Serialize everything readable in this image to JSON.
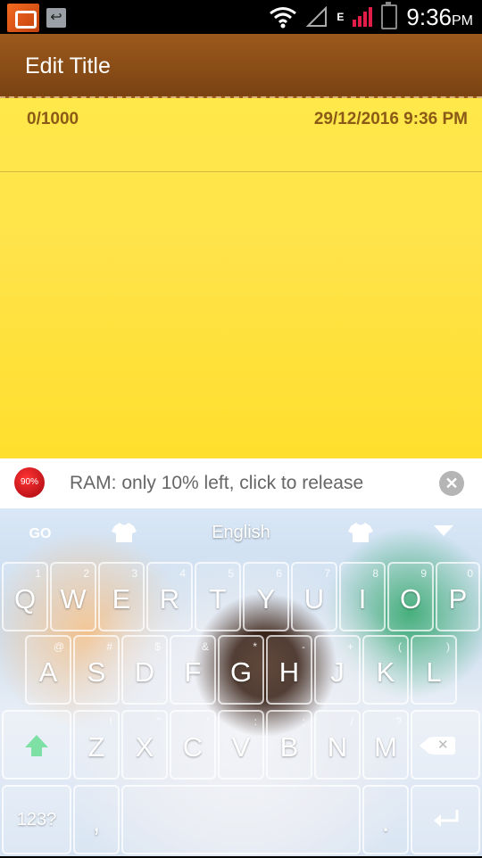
{
  "status_bar": {
    "time": "9:36",
    "ampm": "PM",
    "network": "E"
  },
  "title_bar": {
    "title": "Edit Title"
  },
  "note": {
    "char_count": "0/1000",
    "datetime": "29/12/2016   9:36 PM"
  },
  "ram_banner": {
    "badge": "90%",
    "text": "RAM: only 10% left, click to release",
    "close": "✕"
  },
  "keyboard": {
    "go_logo": "GO",
    "language": "English",
    "row1": [
      {
        "key": "Q",
        "hint": "1"
      },
      {
        "key": "W",
        "hint": "2"
      },
      {
        "key": "E",
        "hint": "3"
      },
      {
        "key": "R",
        "hint": "4"
      },
      {
        "key": "T",
        "hint": "5"
      },
      {
        "key": "Y",
        "hint": "6"
      },
      {
        "key": "U",
        "hint": "7"
      },
      {
        "key": "I",
        "hint": "8"
      },
      {
        "key": "O",
        "hint": "9"
      },
      {
        "key": "P",
        "hint": "0"
      }
    ],
    "row2": [
      {
        "key": "A",
        "hint": "@"
      },
      {
        "key": "S",
        "hint": "#"
      },
      {
        "key": "D",
        "hint": "$"
      },
      {
        "key": "F",
        "hint": "&"
      },
      {
        "key": "G",
        "hint": "*"
      },
      {
        "key": "H",
        "hint": "-"
      },
      {
        "key": "J",
        "hint": "+"
      },
      {
        "key": "K",
        "hint": "("
      },
      {
        "key": "L",
        "hint": ")"
      }
    ],
    "row3": [
      {
        "key": "Z",
        "hint": "!"
      },
      {
        "key": "X",
        "hint": "\""
      },
      {
        "key": "C",
        "hint": "'"
      },
      {
        "key": "V",
        "hint": ":"
      },
      {
        "key": "B",
        "hint": ";"
      },
      {
        "key": "N",
        "hint": "/"
      },
      {
        "key": "M",
        "hint": "?"
      }
    ],
    "row4": {
      "symbols": "123?",
      "comma": ",",
      "period": "."
    }
  }
}
